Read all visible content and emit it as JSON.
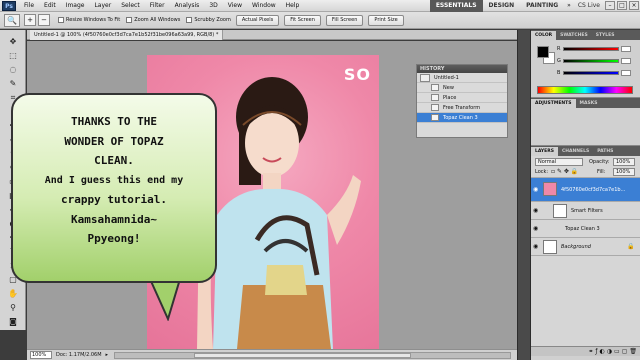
{
  "menubar": {
    "logo": "Ps",
    "items": [
      "File",
      "Edit",
      "Image",
      "Layer",
      "Select",
      "Filter",
      "Analysis",
      "3D",
      "View",
      "Window",
      "Help"
    ],
    "workspaces": [
      "ESSENTIALS",
      "DESIGN",
      "PAINTING"
    ],
    "cslive": "CS Live"
  },
  "options": {
    "resize_windows": "Resize Windows To Fit",
    "zoom_all": "Zoom All Windows",
    "scrubby_zoom": "Scrubby Zoom",
    "actual_pixels": "Actual Pixels",
    "fit_screen": "Fit Screen",
    "fill_screen": "Fill Screen",
    "print_size": "Print Size"
  },
  "document": {
    "tab_title": "Untitled-1 @ 100% (4f50760e0cf3d7ca7e1b52f31be096a63a99, RGB/8) *",
    "watermark": "SO"
  },
  "status": {
    "zoom": "100%",
    "doc_size": "Doc: 1.17M/2.06M"
  },
  "history": {
    "title": "HISTORY",
    "snapshot": "Untitled-1",
    "states": [
      "New",
      "Place",
      "Free Transform",
      "Topaz Clean 3"
    ],
    "active_index": 3
  },
  "panels": {
    "color_tabs": [
      "COLOR",
      "SWATCHES",
      "STYLES"
    ],
    "color_sliders": [
      "R",
      "G",
      "B"
    ],
    "adjust_tabs": [
      "ADJUSTMENTS",
      "MASKS"
    ],
    "layer_tabs": [
      "LAYERS",
      "CHANNELS",
      "PATHS"
    ],
    "blend_mode": "Normal",
    "opacity_label": "Opacity:",
    "opacity": "100%",
    "lock_label": "Lock:",
    "fill_label": "Fill:",
    "fill": "100%"
  },
  "layers": {
    "active_layer": "4f50760e0cf3d7ca7e1b...",
    "smart_filters": "Smart Filters",
    "filter": "Topaz Clean 3",
    "background": "Background"
  },
  "bubble": {
    "lines": [
      "THANKS TO THE",
      "WONDER OF TOPAZ",
      "CLEAN.",
      "And I guess this end my",
      "crappy tutorial.",
      "Kamsahamnida~",
      "Ppyeong!"
    ]
  },
  "colors": {
    "canvas_bg": "#9e9e9e",
    "photo_bg": "#ef88a8",
    "highlight": "#3b7fd4"
  }
}
